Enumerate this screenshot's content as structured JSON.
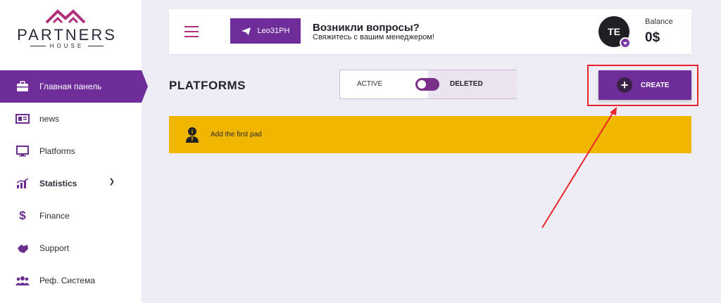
{
  "logo": {
    "name": "PARTNERS",
    "sub": "HOUSE"
  },
  "sidebar": {
    "items": [
      {
        "label": "Главная панель",
        "icon": "briefcase-icon"
      },
      {
        "label": "news",
        "icon": "newspaper-icon"
      },
      {
        "label": "Platforms",
        "icon": "monitor-icon"
      },
      {
        "label": "Statistics",
        "icon": "chart-icon"
      },
      {
        "label": "Finance",
        "icon": "dollar-icon"
      },
      {
        "label": "Support",
        "icon": "handshake-icon"
      },
      {
        "label": "Реф. Система",
        "icon": "users-icon"
      }
    ]
  },
  "header": {
    "telegram_label": "Leo31PH",
    "question_title": "Возникли вопросы?",
    "question_sub": "Свяжитесь с вашим менеджером!",
    "avatar_initials": "TE",
    "balance_label": "Balance",
    "balance_value": "0$"
  },
  "main": {
    "title": "PLATFORMS",
    "toggle": {
      "left_label": "ACTIVE",
      "right_label": "DELETED"
    },
    "create_label": "CREATE",
    "notice": "Add the first pad"
  },
  "colors": {
    "brand_purple": "#6f2d99",
    "notice_yellow": "#f1b600",
    "annotation_red": "#e8262a",
    "background": "#eeedf5"
  }
}
